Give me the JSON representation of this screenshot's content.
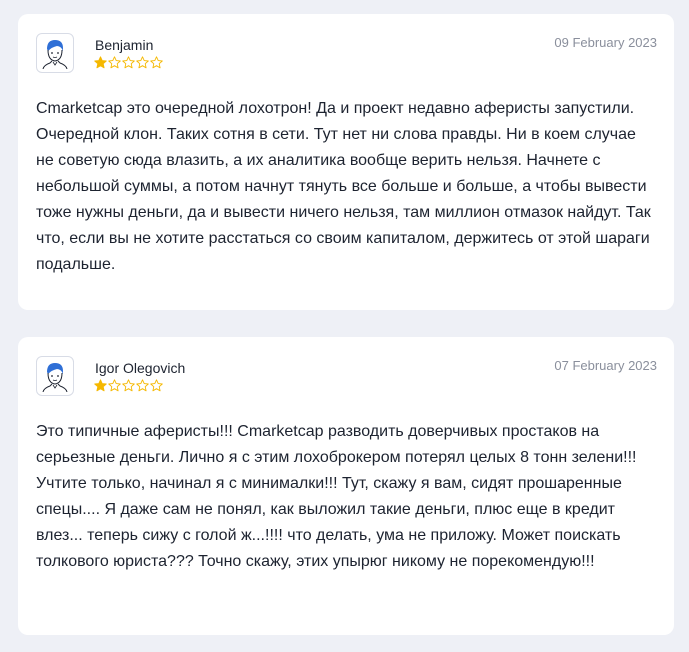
{
  "reviews": [
    {
      "author": "Benjamin",
      "date": "09 February 2023",
      "rating": 1,
      "max_rating": 5,
      "avatar_icon": "user-avatar-icon",
      "text": "Cmarketcap это очередной лохотрон! Да и проект недавно аферисты запустили. Очередной клон. Таких сотня в сети. Тут нет ни слова правды. Ни в коем случае не советую сюда влазить, а их аналитика вообще верить нельзя. Начнете с небольшой суммы, а потом начнут тянуть все больше и больше, а чтобы вывести тоже нужны деньги, да и вывести ничего нельзя, там миллион отмазок найдут. Так что, если вы не хотите расстаться со своим капиталом, держитесь от этой шараги подальше."
    },
    {
      "author": "Igor Olegovich",
      "date": "07 February 2023",
      "rating": 1,
      "max_rating": 5,
      "avatar_icon": "user-avatar-icon",
      "text": "Это типичные аферисты!!! Cmarketcap разводить доверчивых простаков на серьезные деньги. Лично я с этим лохоброкером потерял целых 8 тонн зелени!!! Учтите только, начинал я с минималки!!! Тут, скажу я вам, сидят прошаренные спецы.... Я даже сам не понял, как выложил такие деньги, плюс еще в кредит влез... теперь сижу с голой ж...!!!! что делать, ума не приложу. Может поискать толкового юриста??? Точно скажу, этих упырюг никому не порекомендую!!!"
    }
  ],
  "colors": {
    "page_background": "#eef0f6",
    "card_background": "#ffffff",
    "star_filled": "#f5b800",
    "star_outline": "#f5b800",
    "avatar_hair": "#2f6fd6",
    "date_text": "#8a8f9c"
  }
}
